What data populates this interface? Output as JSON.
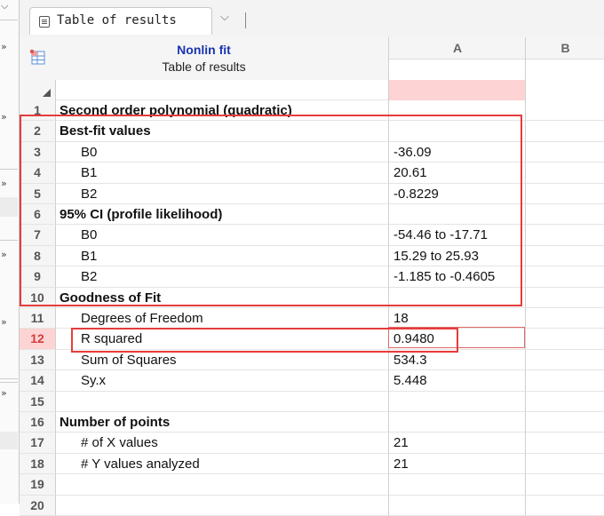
{
  "tab": {
    "label": "Table of results",
    "dropdown_glyph": "⌵"
  },
  "header": {
    "title": "Nonlin fit",
    "subtitle": "Table of results"
  },
  "columns": [
    "A",
    "B"
  ],
  "rows": [
    {
      "num": "1",
      "label": "Second order polynomial (quadratic)",
      "value": "",
      "style": "bold"
    },
    {
      "num": "2",
      "label": "Best-fit values",
      "value": "",
      "style": "bold"
    },
    {
      "num": "3",
      "label": "B0",
      "value": "-36.09",
      "style": "ind"
    },
    {
      "num": "4",
      "label": "B1",
      "value": "20.61",
      "style": "ind"
    },
    {
      "num": "5",
      "label": "B2",
      "value": "-0.8229",
      "style": "ind"
    },
    {
      "num": "6",
      "label": "95% CI (profile likelihood)",
      "value": "",
      "style": "bold"
    },
    {
      "num": "7",
      "label": "B0",
      "value": "-54.46 to -17.71",
      "style": "ind"
    },
    {
      "num": "8",
      "label": "B1",
      "value": "15.29 to 25.93",
      "style": "ind"
    },
    {
      "num": "9",
      "label": "B2",
      "value": "-1.185 to -0.4605",
      "style": "ind"
    },
    {
      "num": "10",
      "label": "Goodness of Fit",
      "value": "",
      "style": "bold"
    },
    {
      "num": "11",
      "label": "Degrees of Freedom",
      "value": "18",
      "style": "ind"
    },
    {
      "num": "12",
      "label": "R squared",
      "value": "0.9480",
      "style": "ind",
      "selected": true
    },
    {
      "num": "13",
      "label": "Sum of Squares",
      "value": "534.3",
      "style": "ind"
    },
    {
      "num": "14",
      "label": "Sy.x",
      "value": "5.448",
      "style": "ind"
    },
    {
      "num": "15",
      "label": "",
      "value": "",
      "style": "ind"
    },
    {
      "num": "16",
      "label": "Number of points",
      "value": "",
      "style": "bold"
    },
    {
      "num": "17",
      "label": "# of X values",
      "value": "21",
      "style": "ind"
    },
    {
      "num": "18",
      "label": "# Y values analyzed",
      "value": "21",
      "style": "ind"
    },
    {
      "num": "19",
      "label": "",
      "value": "",
      "style": "ind"
    },
    {
      "num": "20",
      "label": "",
      "value": "",
      "style": "ind"
    }
  ],
  "left_strip": {
    "chevron_glyph": "»"
  },
  "colors": {
    "accent_title": "#1a34b0",
    "highlight": "#e63c3c",
    "selected_row_bg": "#fdd3d3"
  }
}
